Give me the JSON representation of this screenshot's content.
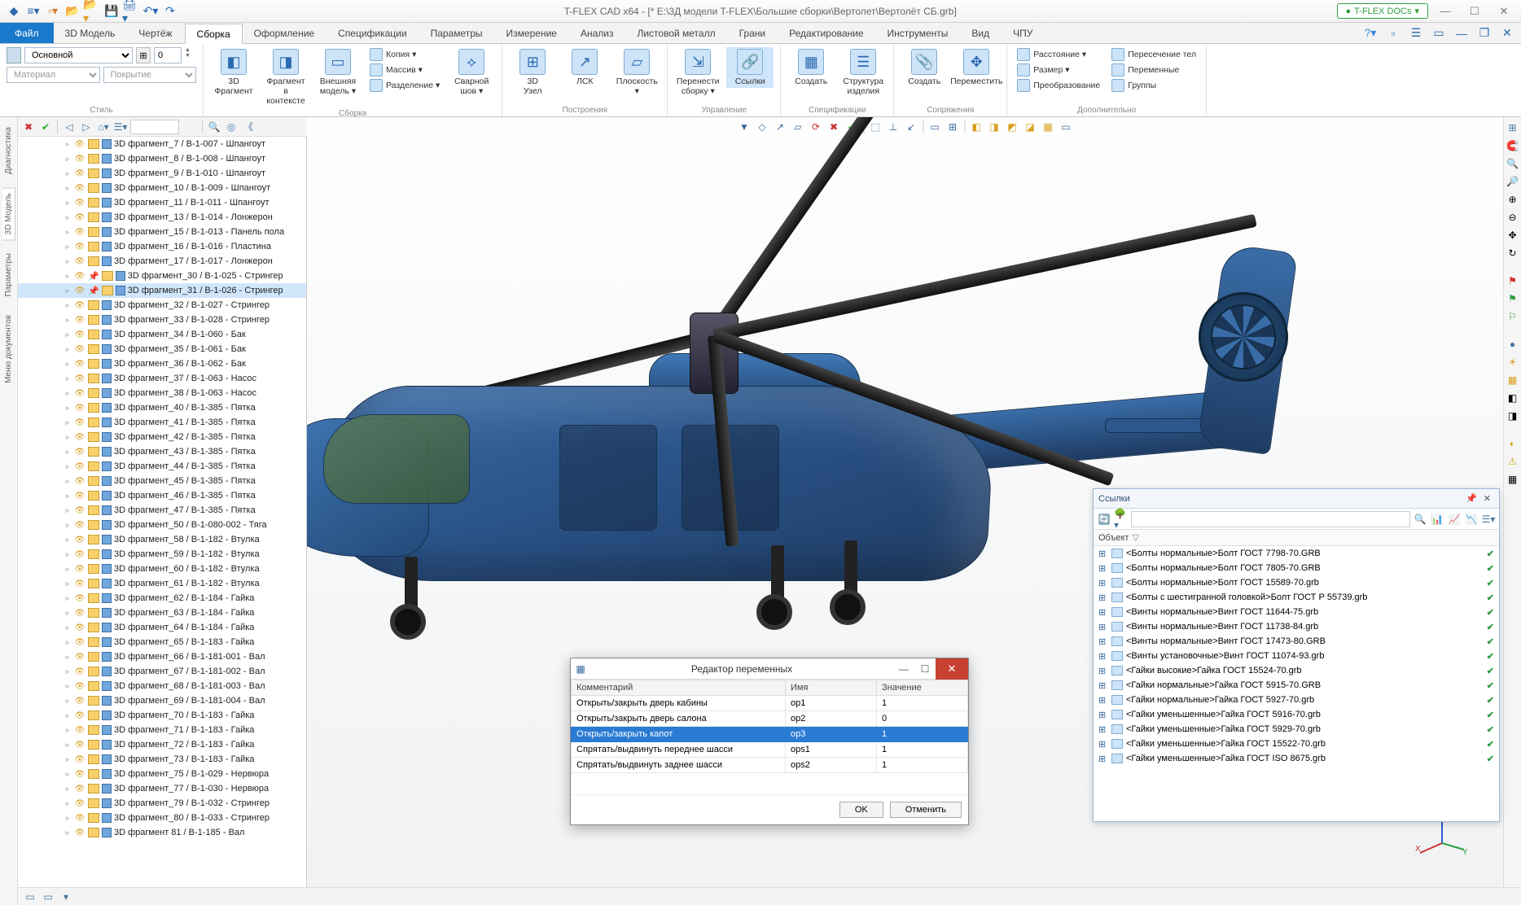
{
  "title": "T-FLEX CAD x64 - [* E:\\3Д модели T-FLEX\\Большие сборки\\Вертолет\\Вертолёт СБ.grb]",
  "docs_button": "T-FLEX DOCs",
  "file_button": "Файл",
  "tabs": [
    "3D Модель",
    "Чертёж",
    "Сборка",
    "Оформление",
    "Спецификации",
    "Параметры",
    "Измерение",
    "Анализ",
    "Листовой металл",
    "Грани",
    "Редактирование",
    "Инструменты",
    "Вид",
    "ЧПУ"
  ],
  "active_tab": "Сборка",
  "style": {
    "main_combo": "Основной",
    "spin": "0",
    "material": "Материал",
    "coating": "Покрытие",
    "group_label": "Стиль"
  },
  "ribbon_groups": {
    "sborka": {
      "label": "Сборка",
      "big": [
        {
          "label": "3D\nФрагмент",
          "icon": "◧"
        },
        {
          "label": "Фрагмент в\nконтексте",
          "icon": "◨"
        },
        {
          "label": "Внешняя\nмодель ▾",
          "icon": "▭"
        }
      ],
      "small": [
        "Копия ▾",
        "Массив ▾",
        "Разделение ▾"
      ],
      "small2": {
        "label": "Сварной\nшов ▾",
        "icon": "⟡"
      }
    },
    "build": {
      "label": "Построения",
      "big": [
        {
          "label": "3D\nУзел",
          "icon": "⊞"
        },
        {
          "label": "ЛСК",
          "icon": "↗"
        },
        {
          "label": "Плоскость\n▾",
          "icon": "▱"
        }
      ]
    },
    "manage": {
      "label": "Управление",
      "big": [
        {
          "label": "Перенести\nсборку ▾",
          "icon": "⇲"
        },
        {
          "label": "Ссылки",
          "icon": "🔗",
          "active": true
        }
      ]
    },
    "spec": {
      "label": "Спецификации",
      "big": [
        {
          "label": "Создать",
          "icon": "▦"
        },
        {
          "label": "Структура\nизделия",
          "icon": "☰"
        }
      ]
    },
    "mates": {
      "label": "Сопряжения",
      "big": [
        {
          "label": "Создать",
          "icon": "📎"
        },
        {
          "label": "Переместить",
          "icon": "✥"
        }
      ]
    },
    "extra": {
      "label": "Дополнительно",
      "small": [
        "Расстояние ▾",
        "Размер ▾",
        "Преобразование"
      ],
      "small2": [
        "Пересечение тел",
        "Переменные",
        "Группы"
      ]
    }
  },
  "spine_tabs": [
    "Диагностика",
    "3D Модель",
    "Параметры",
    "Меню документов"
  ],
  "tree_items": [
    {
      "t": "3D фрагмент_7 / В-1-007 - Шпангоут"
    },
    {
      "t": "3D фрагмент_8 / В-1-008 - Шпангоут"
    },
    {
      "t": "3D фрагмент_9 / В-1-010 - Шпангоут"
    },
    {
      "t": "3D фрагмент_10 / В-1-009 - Шпангоут"
    },
    {
      "t": "3D фрагмент_11 / В-1-011 - Шпангоут"
    },
    {
      "t": "3D фрагмент_13 / В-1-014 - Лонжерон"
    },
    {
      "t": "3D фрагмент_15 / В-1-013 - Панель пола"
    },
    {
      "t": "3D фрагмент_16 / В-1-016 - Пластина"
    },
    {
      "t": "3D фрагмент_17 / В-1-017 - Лонжерон"
    },
    {
      "t": "3D фрагмент_30 / В-1-025 - Стрингер",
      "pin": true
    },
    {
      "t": "3D фрагмент_31 / В-1-026 - Стрингер",
      "sel": true,
      "pin": true
    },
    {
      "t": "3D фрагмент_32 / В-1-027 - Стрингер"
    },
    {
      "t": "3D фрагмент_33 / В-1-028 - Стрингер"
    },
    {
      "t": "3D фрагмент_34 / В-1-060 - Бак"
    },
    {
      "t": "3D фрагмент_35 / В-1-061 - Бак"
    },
    {
      "t": "3D фрагмент_36 / В-1-062 - Бак"
    },
    {
      "t": "3D фрагмент_37 / В-1-063 - Насос"
    },
    {
      "t": "3D фрагмент_38 / В-1-063 - Насос"
    },
    {
      "t": "3D фрагмент_40 / В-1-385 - Пятка"
    },
    {
      "t": "3D фрагмент_41 / В-1-385 - Пятка"
    },
    {
      "t": "3D фрагмент_42 / В-1-385 - Пятка"
    },
    {
      "t": "3D фрагмент_43 / В-1-385 - Пятка"
    },
    {
      "t": "3D фрагмент_44 / В-1-385 - Пятка"
    },
    {
      "t": "3D фрагмент_45 / В-1-385 - Пятка"
    },
    {
      "t": "3D фрагмент_46 / В-1-385 - Пятка"
    },
    {
      "t": "3D фрагмент_47 / В-1-385 - Пятка"
    },
    {
      "t": "3D фрагмент_50 / В-1-080-002 - Тяга"
    },
    {
      "t": "3D фрагмент_58 / В-1-182 - Втулка"
    },
    {
      "t": "3D фрагмент_59 / В-1-182 - Втулка"
    },
    {
      "t": "3D фрагмент_60 / В-1-182 - Втулка"
    },
    {
      "t": "3D фрагмент_61 / В-1-182 - Втулка"
    },
    {
      "t": "3D фрагмент_62 / В-1-184 - Гайка"
    },
    {
      "t": "3D фрагмент_63 / В-1-184 - Гайка"
    },
    {
      "t": "3D фрагмент_64 / В-1-184 - Гайка"
    },
    {
      "t": "3D фрагмент_65 / В-1-183 - Гайка"
    },
    {
      "t": "3D фрагмент_66 / В-1-181-001 - Вал"
    },
    {
      "t": "3D фрагмент_67 / В-1-181-002 - Вал"
    },
    {
      "t": "3D фрагмент_68 / В-1-181-003 - Вал"
    },
    {
      "t": "3D фрагмент_69 / В-1-181-004 - Вал"
    },
    {
      "t": "3D фрагмент_70 / В-1-183 - Гайка"
    },
    {
      "t": "3D фрагмент_71 / В-1-183 - Гайка"
    },
    {
      "t": "3D фрагмент_72 / В-1-183 - Гайка"
    },
    {
      "t": "3D фрагмент_73 / В-1-183 - Гайка"
    },
    {
      "t": "3D фрагмент_75 / В-1-029 - Нервюра"
    },
    {
      "t": "3D фрагмент_77 / В-1-030 - Нервюра"
    },
    {
      "t": "3D фрагмент_79 / В-1-032 - Стрингер"
    },
    {
      "t": "3D фрагмент_80 / В-1-033 - Стрингер"
    },
    {
      "t": "3D фрагмент 81 / В-1-185 - Вал"
    }
  ],
  "links": {
    "title": "Ссылки",
    "header": "Объект",
    "search_placeholder": "",
    "items": [
      "<Болты нормальные>Болт ГОСТ 7798-70.GRB",
      "<Болты нормальные>Болт ГОСТ 7805-70.GRB",
      "<Болты нормальные>Болт ГОСТ 15589-70.grb",
      "<Болты с шестигранной головкой>Болт ГОСТ Р 55739.grb",
      "<Винты нормальные>Винт ГОСТ 11644-75.grb",
      "<Винты нормальные>Винт ГОСТ 11738-84.grb",
      "<Винты нормальные>Винт ГОСТ 17473-80.GRB",
      "<Винты установочные>Винт ГОСТ 11074-93.grb",
      "<Гайки высокие>Гайка ГОСТ 15524-70.grb",
      "<Гайки нормальные>Гайка ГОСТ 5915-70.GRB",
      "<Гайки нормальные>Гайка ГОСТ 5927-70.grb",
      "<Гайки уменьшенные>Гайка ГОСТ 5916-70.grb",
      "<Гайки уменьшенные>Гайка ГОСТ 5929-70.grb",
      "<Гайки уменьшенные>Гайка ГОСТ 15522-70.grb",
      "<Гайки уменьшенные>Гайка ГОСТ ISO 8675.grb"
    ]
  },
  "var_editor": {
    "title": "Редактор переменных",
    "headers": [
      "Комментарий",
      "Имя",
      "Значение"
    ],
    "rows": [
      {
        "c": "Открыть/закрыть дверь кабины",
        "n": "op1",
        "v": "1"
      },
      {
        "c": "Открыть/закрыть дверь салона",
        "n": "op2",
        "v": "0"
      },
      {
        "c": "Открыть/закрыть капот",
        "n": "op3",
        "v": "1",
        "sel": true
      },
      {
        "c": "Спрятать/выдвинуть переднее шасси",
        "n": "ops1",
        "v": "1"
      },
      {
        "c": "Спрятать/выдвинуть заднее шасси",
        "n": "ops2",
        "v": "1"
      }
    ],
    "ok": "OK",
    "cancel": "Отменить"
  }
}
